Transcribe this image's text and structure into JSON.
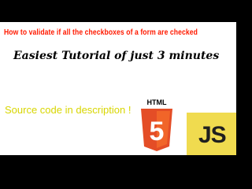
{
  "headline": "How to validate if all the checkboxes of a form are checked",
  "subtitle": "Easiest Tutorial of  just 3 minutes",
  "footnote": "Source code in description !",
  "badges": {
    "html5_word": "HTML",
    "html5_number": "5",
    "js_text": "JS"
  },
  "colors": {
    "background_bars": "#000000",
    "panel": "#ffffff",
    "headline": "#ff1a00",
    "footnote": "#d8d600",
    "html5_orange": "#e44d26",
    "html5_light_orange": "#f16529",
    "js_yellow": "#f0db4f"
  },
  "icons": [
    "html5-logo-icon",
    "javascript-logo-icon"
  ]
}
